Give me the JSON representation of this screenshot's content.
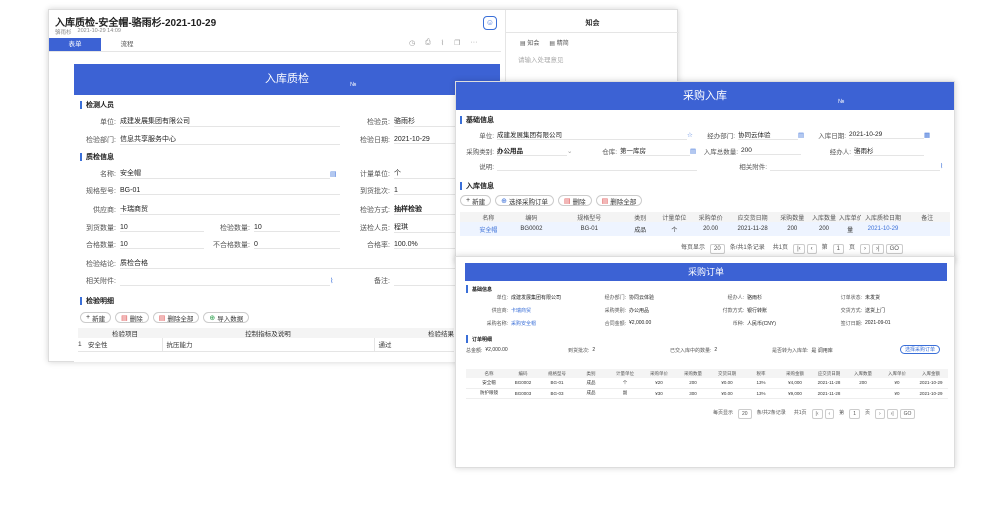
{
  "main": {
    "title": "入库质检-安全帽-骆雨杉-2021-10-29",
    "author": "骆雨杉",
    "date": "2021-10-29 14:09",
    "tabs": [
      "表单",
      "流程"
    ],
    "comment_title": "知会",
    "comment_tabs": [
      "知会",
      "精简"
    ],
    "comment_placeholder": "请输入处理意见"
  },
  "qc": {
    "title": "入库质检",
    "no": "№",
    "sec_people": "检测人员",
    "unit_l": "单位:",
    "unit_v": "成建发展集团有限公司",
    "inspector_l": "检验员:",
    "inspector_v": "骆雨杉",
    "dept_l": "检验部门:",
    "dept_v": "信息共享服务中心",
    "date_l": "检验日期:",
    "date_v": "2021-10-29",
    "sec_info": "质检信息",
    "name_l": "名称:",
    "name_v": "安全帽",
    "unit2_l": "计量单位:",
    "unit2_v": "个",
    "spec_l": "规格型号:",
    "spec_v": "BG-01",
    "batch_l": "到货批次:",
    "batch_v": "1",
    "supplier_l": "供应商:",
    "supplier_v": "卡瑞商贸",
    "method_l": "检验方式:",
    "method_v": "抽样检验",
    "arrive_l": "到货数量:",
    "arrive_v": "10",
    "checked_l": "检验数量:",
    "checked_v": "10",
    "sender_l": "送检人员:",
    "sender_v": "程琪",
    "pass_l": "合格数量:",
    "pass_v": "10",
    "fail_l": "不合格数量:",
    "fail_v": "0",
    "rate_l": "合格率:",
    "rate_v": "100.0%",
    "result_l": "检验结论:",
    "result_v": "质检合格",
    "attach_l": "相关附件:",
    "remark_l": "备注:",
    "sec_detail": "检验明细",
    "btns": [
      "新建",
      "删除",
      "删除全部",
      "导入数据"
    ],
    "cols": [
      "检验项目",
      "控制指标及说明",
      "检验结果"
    ],
    "rows": [
      [
        "1",
        "安全性",
        "抗压能力",
        "通过"
      ]
    ]
  },
  "po": {
    "title": "采购入库",
    "no": "№",
    "sec_base": "基础信息",
    "unit_l": "单位:",
    "unit_v": "成建发展集团有限公司",
    "dept_l": "经办部门:",
    "dept_v": "协同云体验",
    "date_l": "入库日期:",
    "date_v": "2021-10-29",
    "type_l": "采购类别:",
    "type_v": "办公用品",
    "wh_l": "仓库:",
    "wh_v": "第一库房",
    "total_l": "入库总数量:",
    "total_v": "200",
    "handler_l": "经办人:",
    "handler_v": "骆雨杉",
    "desc_l": "说明:",
    "attach_l": "相关附件:",
    "sec_info": "入库信息",
    "btns": [
      "新建",
      "选择采购订单",
      "删除",
      "删除全部"
    ],
    "cols": [
      "名称",
      "编码",
      "规格型号",
      "类别",
      "计量单位",
      "采购单价",
      "应交货日期",
      "采购数量",
      "入库数量",
      "入库单价",
      "入库质检日期",
      "备注"
    ],
    "row": [
      "安全帽",
      "BG0002",
      "BG-01",
      "成品",
      "个",
      "20.00",
      "2021-11-28",
      "200",
      "200",
      "量",
      "2021-10-29",
      ""
    ],
    "pager": {
      "per": "每页显示",
      "size": "20",
      "unit": "条/共1条记录",
      "pages": "共1页",
      "page_l": "第",
      "page": "1",
      "page_r": "页",
      "go": "GO"
    }
  },
  "order": {
    "title": "采购订单",
    "sec_base": "基础信息",
    "f1": [
      [
        "单位:",
        "成建发展集团有限公司"
      ],
      [
        "经办部门:",
        "协同云体验"
      ],
      [
        "经办人:",
        "骆雨杉"
      ],
      [
        "订单状态:",
        "未发货"
      ]
    ],
    "f2": [
      [
        "供应商:",
        "卡瑞商贸"
      ],
      [
        "采购类别:",
        "办公用品"
      ],
      [
        "付款方式:",
        "银行转账"
      ],
      [
        "交货方式:",
        "送货上门"
      ]
    ],
    "f3": [
      [
        "采购名称:",
        "采购安全帽"
      ],
      [
        "合同金额:",
        "¥2,000.00"
      ],
      [
        "币种:",
        "人民币(CNY)"
      ],
      [
        "签订日期:",
        "2021-09-01"
      ]
    ],
    "sec_detail": "订单明细",
    "sum": [
      [
        "总金额:",
        "¥2,000.00"
      ],
      [
        "到货批次:",
        "2"
      ],
      [
        "已交入库中的数量:",
        "2"
      ],
      [
        "是否转为入库单:",
        "是  调用库"
      ]
    ],
    "btn": "选择采购订单",
    "cols": [
      "名称",
      "编码",
      "规格型号",
      "类别",
      "计量单位",
      "采购单价",
      "采购数量",
      "交货日期",
      "税率",
      "采购金额",
      "应交货日期",
      "入库数量",
      "入库单价",
      "入库金额"
    ],
    "rows": [
      [
        "安全帽",
        "BG0002",
        "BG-01",
        "成品",
        "个",
        "¥20",
        "200",
        "¥0.00",
        "13%",
        "¥4,000",
        "2021-11-28",
        "200",
        "¥0",
        "2021-10-29"
      ],
      [
        "防护眼镜",
        "BG0003",
        "BG-03",
        "成品",
        "副",
        "¥30",
        "300",
        "¥0.00",
        "13%",
        "¥9,000",
        "2021-11-28",
        "",
        "¥0",
        "2021-10-29"
      ]
    ],
    "pager": {
      "per": "每页显示",
      "size": "20",
      "unit": "条/共2条记录",
      "pages": "共1页",
      "page_l": "第",
      "page": "1",
      "page_r": "页",
      "go": "GO"
    }
  }
}
